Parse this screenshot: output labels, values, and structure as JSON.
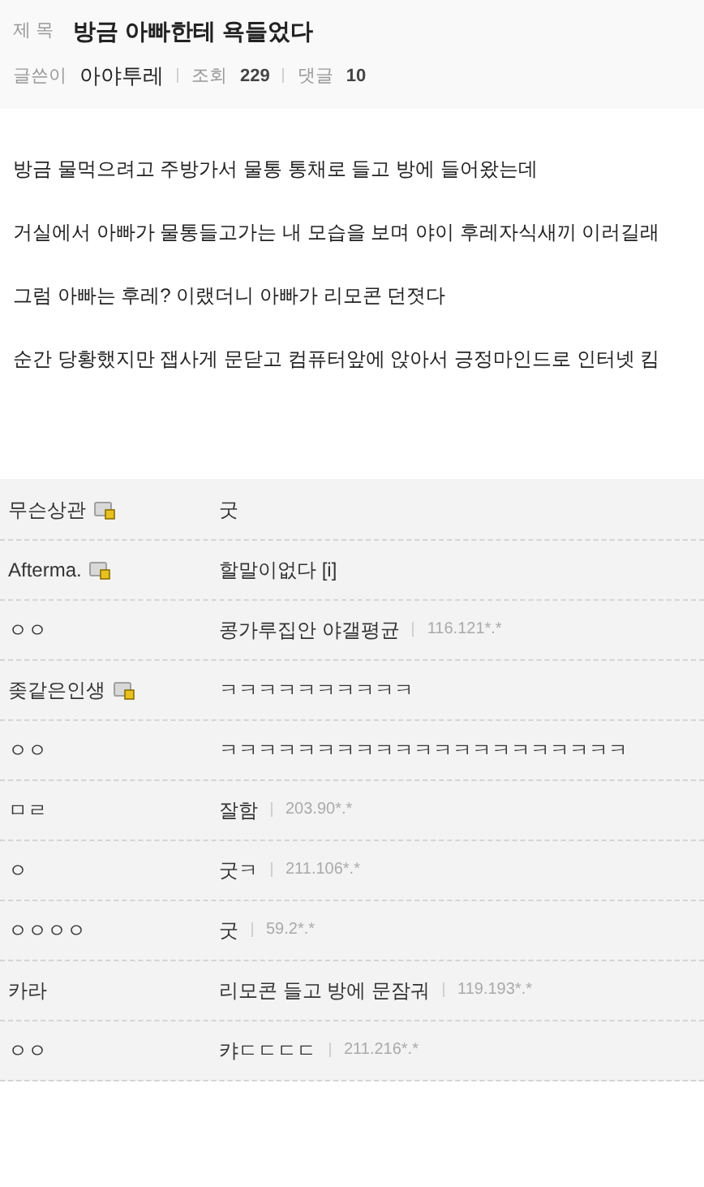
{
  "post": {
    "title_label": "제 목",
    "title": "방금 아빠한테 욕들었다",
    "author_label": "글쓴이",
    "author": "아야투레",
    "views_label": "조회",
    "views": "229",
    "comments_label": "댓글",
    "comments": "10"
  },
  "body": [
    "방금 물먹으려고 주방가서 물통 통채로 들고 방에 들어왔는데",
    "거실에서 아빠가 물통들고가는 내 모습을 보며 야이 후레자식새끼 이러길래",
    "그럼 아빠는 후레? 이랬더니 아빠가 리모콘 던졋다",
    "순간 당황했지만 잽사게 문닫고 컴퓨터앞에 앉아서 긍정마인드로 인터넷 킴"
  ],
  "comments": [
    {
      "nick": "무슨상관",
      "member": true,
      "text": "굿"
    },
    {
      "nick": "Afterma.",
      "member": true,
      "text": "할말이없다 [i]"
    },
    {
      "nick": "ㅇㅇ",
      "member": false,
      "text": "콩가루집안 야갤평균",
      "ip": "116.121*.*"
    },
    {
      "nick": "좆같은인생",
      "member": true,
      "text": "ㅋㅋㅋㅋㅋㅋㅋㅋㅋㅋ"
    },
    {
      "nick": "ㅇㅇ",
      "member": false,
      "text": "ㅋㅋㅋㅋㅋㅋㅋㅋㅋㅋㅋㅋㅋㅋㅋㅋㅋㅋㅋㅋㅋ"
    },
    {
      "nick": "ㅁㄹ",
      "member": false,
      "text": "잘함",
      "ip": "203.90*.*"
    },
    {
      "nick": "ㅇ",
      "member": false,
      "text": "굿ㅋ",
      "ip": "211.106*.*"
    },
    {
      "nick": "ㅇㅇㅇㅇ",
      "member": false,
      "text": "굿",
      "ip": "59.2*.*"
    },
    {
      "nick": "카라",
      "member": false,
      "text": "리모콘 들고 방에 문잠궈",
      "ip": "119.193*.*"
    },
    {
      "nick": "ㅇㅇ",
      "member": false,
      "text": "캬ㄷㄷㄷㄷ",
      "ip": "211.216*.*"
    }
  ]
}
